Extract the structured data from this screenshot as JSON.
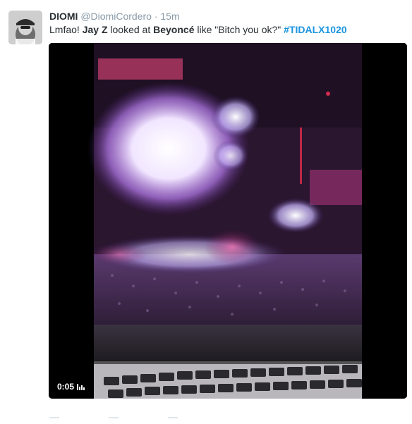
{
  "tweet": {
    "fullname": "DIOMI",
    "username": "@DiomiCordero",
    "separator": "·",
    "time": "15m",
    "text_parts": {
      "p1": "Lmfao! ",
      "p2": "Jay Z",
      "p3": " looked at ",
      "p4": "Beyoncé",
      "p5": " like \"Bitch you ok?\" ",
      "hashtag": "#TIDALX1020"
    }
  },
  "video": {
    "duration": "0:05",
    "sound_icon": "audio-bars-icon"
  },
  "footer_icons": [
    "reply-icon",
    "retweet-icon",
    "like-icon"
  ],
  "colors": {
    "hashtag": "#1b95e0",
    "muted": "#8899a6",
    "text": "#292f33"
  }
}
